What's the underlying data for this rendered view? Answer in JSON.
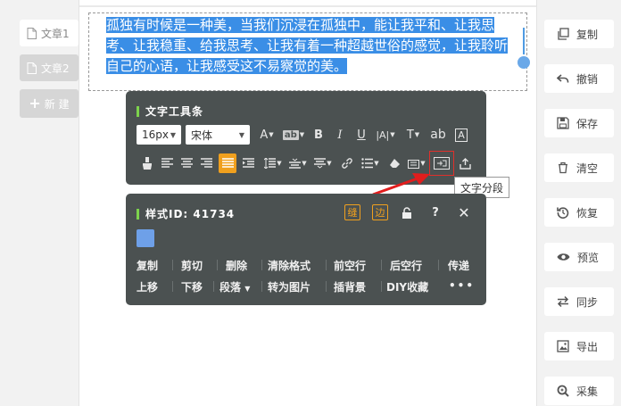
{
  "docs": [
    {
      "label": "文章1",
      "active": true
    },
    {
      "label": "文章2",
      "active": false
    }
  ],
  "new_button": "新 建",
  "editor": {
    "selected_text": "孤独有时候是一种美，当我们沉浸在孤独中，能让我平和、让我思考、让我稳重、给我思考、让我有着一种超越世俗的感觉，让我聆听自己的心语，让我感受这不易察觉的美。"
  },
  "text_toolbar": {
    "title": "文字工具条",
    "font_size": "16px",
    "font_family": "宋体",
    "tooltip": "文字分段"
  },
  "style_panel": {
    "title": "样式ID: 41734",
    "tag_buttons": [
      "缝",
      "边"
    ],
    "swatch_color": "#6ea0e8",
    "row1": [
      "复制",
      "剪切",
      "删除",
      "清除格式",
      "前空行",
      "后空行",
      "传递"
    ],
    "row2": [
      "上移",
      "下移",
      "段落",
      "转为图片",
      "插背景",
      "DIY收藏",
      "•••"
    ]
  },
  "right_buttons": [
    {
      "label": "复制",
      "icon": "copy-icon"
    },
    {
      "label": "撤销",
      "icon": "undo-icon"
    },
    {
      "label": "保存",
      "icon": "save-icon"
    },
    {
      "label": "清空",
      "icon": "trash-icon"
    },
    {
      "label": "恢复",
      "icon": "restore-icon"
    },
    {
      "label": "预览",
      "icon": "eye-icon"
    },
    {
      "label": "同步",
      "icon": "sync-icon"
    },
    {
      "label": "导出",
      "icon": "export-icon"
    },
    {
      "label": "采集",
      "icon": "search-icon"
    }
  ],
  "colors": {
    "accent": "#f0a01e",
    "selection": "#3a8ee6",
    "panel": "#4b5151",
    "highlight": "#e0302b"
  }
}
